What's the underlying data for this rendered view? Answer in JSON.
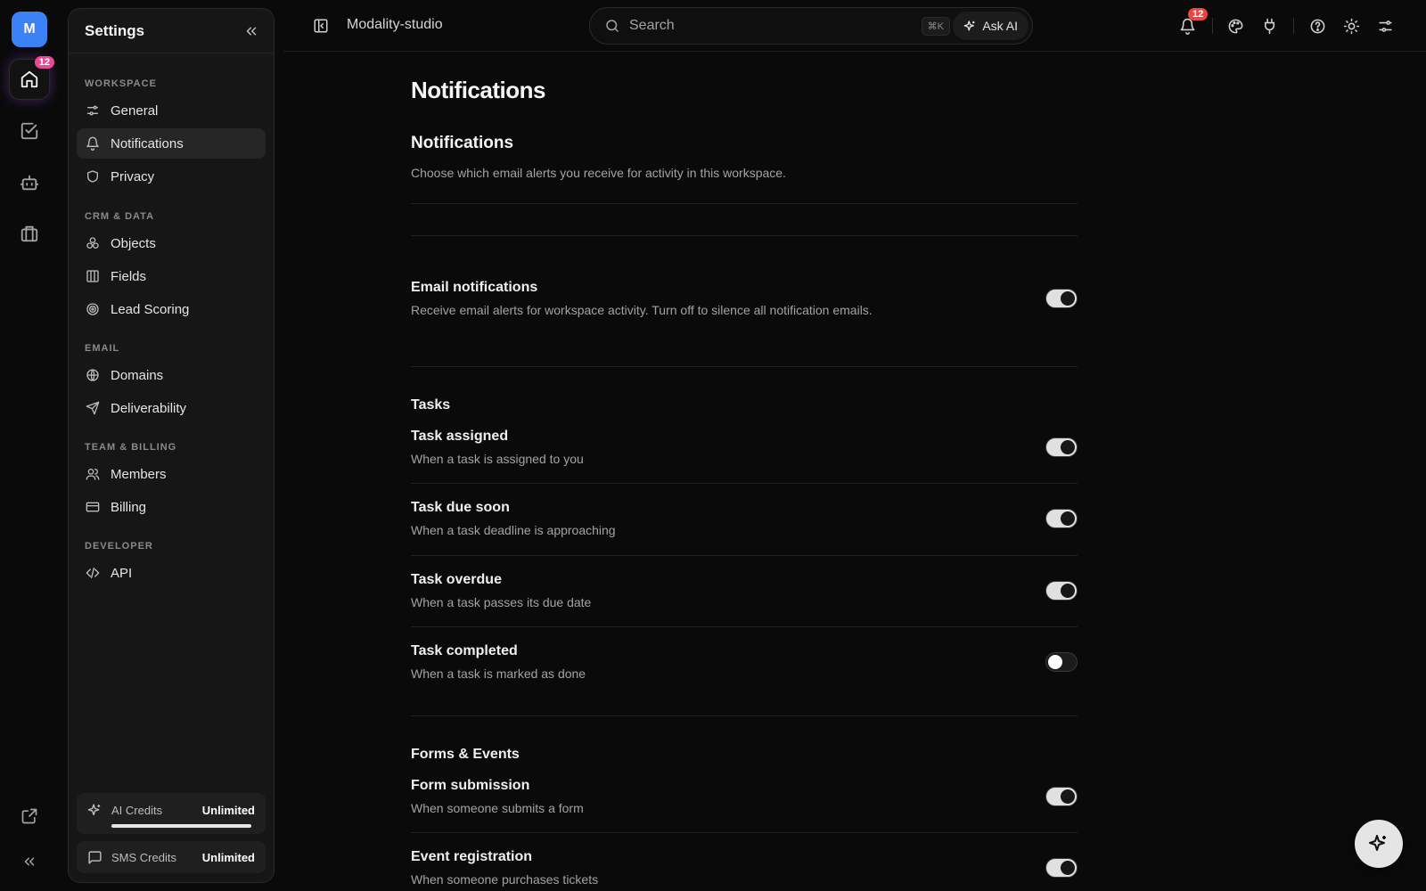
{
  "rail": {
    "avatar_initial": "M",
    "home_badge": "12",
    "items": [
      "home-icon",
      "task-check-icon",
      "bot-icon",
      "briefcase-icon"
    ],
    "bottom_items": [
      "external-link-icon",
      "collapse-rail-icon"
    ]
  },
  "settings_panel": {
    "title": "Settings",
    "groups": [
      {
        "label": "WORKSPACE",
        "items": [
          "General",
          "Notifications",
          "Privacy"
        ]
      },
      {
        "label": "CRM & DATA",
        "items": [
          "Objects",
          "Fields",
          "Lead Scoring"
        ]
      },
      {
        "label": "EMAIL",
        "items": [
          "Domains",
          "Deliverability"
        ]
      },
      {
        "label": "TEAM & BILLING",
        "items": [
          "Members",
          "Billing"
        ]
      },
      {
        "label": "DEVELOPER",
        "items": [
          "API"
        ]
      }
    ],
    "active_item": "Notifications",
    "credits": {
      "ai_label": "AI Credits",
      "ai_value": "Unlimited",
      "ai_usage_fraction": 1.0,
      "sms_label": "SMS Credits",
      "sms_value": "Unlimited"
    }
  },
  "topbar": {
    "workspace_name": "Modality-studio",
    "search_placeholder": "Search",
    "search_shortcut": "⌘K",
    "ask_ai_label": "Ask AI",
    "notification_badge": "12"
  },
  "main": {
    "page_title": "Notifications",
    "section_title": "Notifications",
    "section_description": "Choose which email alerts you receive for activity in this workspace.",
    "master": {
      "title": "Email notifications",
      "description": "Receive email alerts for workspace activity. Turn off to silence all notification emails.",
      "enabled": true
    },
    "tasks": {
      "heading": "Tasks",
      "rows": [
        {
          "title": "Task assigned",
          "description": "When a task is assigned to you",
          "enabled": true
        },
        {
          "title": "Task due soon",
          "description": "When a task deadline is approaching",
          "enabled": true
        },
        {
          "title": "Task overdue",
          "description": "When a task passes its due date",
          "enabled": true
        },
        {
          "title": "Task completed",
          "description": "When a task is marked as done",
          "enabled": false
        }
      ]
    },
    "forms": {
      "heading": "Forms & Events",
      "rows": [
        {
          "title": "Form submission",
          "description": "When someone submits a form",
          "enabled": true
        },
        {
          "title": "Event registration",
          "description": "When someone purchases tickets",
          "enabled": true
        }
      ]
    }
  },
  "colors": {
    "background": "#0a0a0a",
    "panel": "#161616",
    "avatar": "#3b82f6",
    "rail_badge": "#ec4899",
    "top_badge": "#ef4444"
  }
}
